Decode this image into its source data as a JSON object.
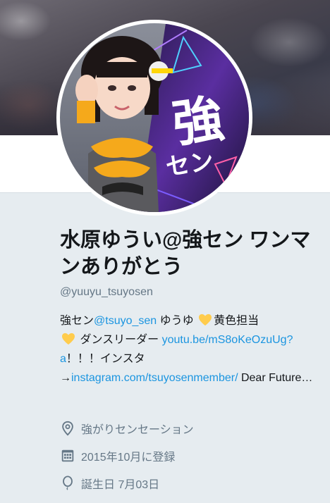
{
  "profile": {
    "name": "水原ゆうい@強セン ワンマンありがとう",
    "handle": "@yuuyu_tsuyosen",
    "bio": {
      "part1": "強セン",
      "mention": "@tsuyo_sen",
      "part2": " ゆうゆ ",
      "part3": "黄色担当",
      "part4": " ダンスリーダー ",
      "link1": "youtu.be/mS8oKeOzuUg?a",
      "part5": "！！！インスタ→",
      "link2": "instagram.com/tsuyosenmember/",
      "part6": " Dear Future…"
    },
    "location": "強がりセンセーション",
    "joined": "2015年10月に登録",
    "birthday": "誕生日 7月03日"
  },
  "avatar_text": {
    "big": "強",
    "small": "セン"
  },
  "colors": {
    "link": "#1b95e0",
    "muted": "#657786",
    "heart": "#ffcc4d",
    "background": "#e6ecf0"
  },
  "icons": {
    "heart": "yellow-heart-icon",
    "location": "location-pin-icon",
    "calendar": "calendar-icon",
    "birthday": "balloon-icon"
  }
}
